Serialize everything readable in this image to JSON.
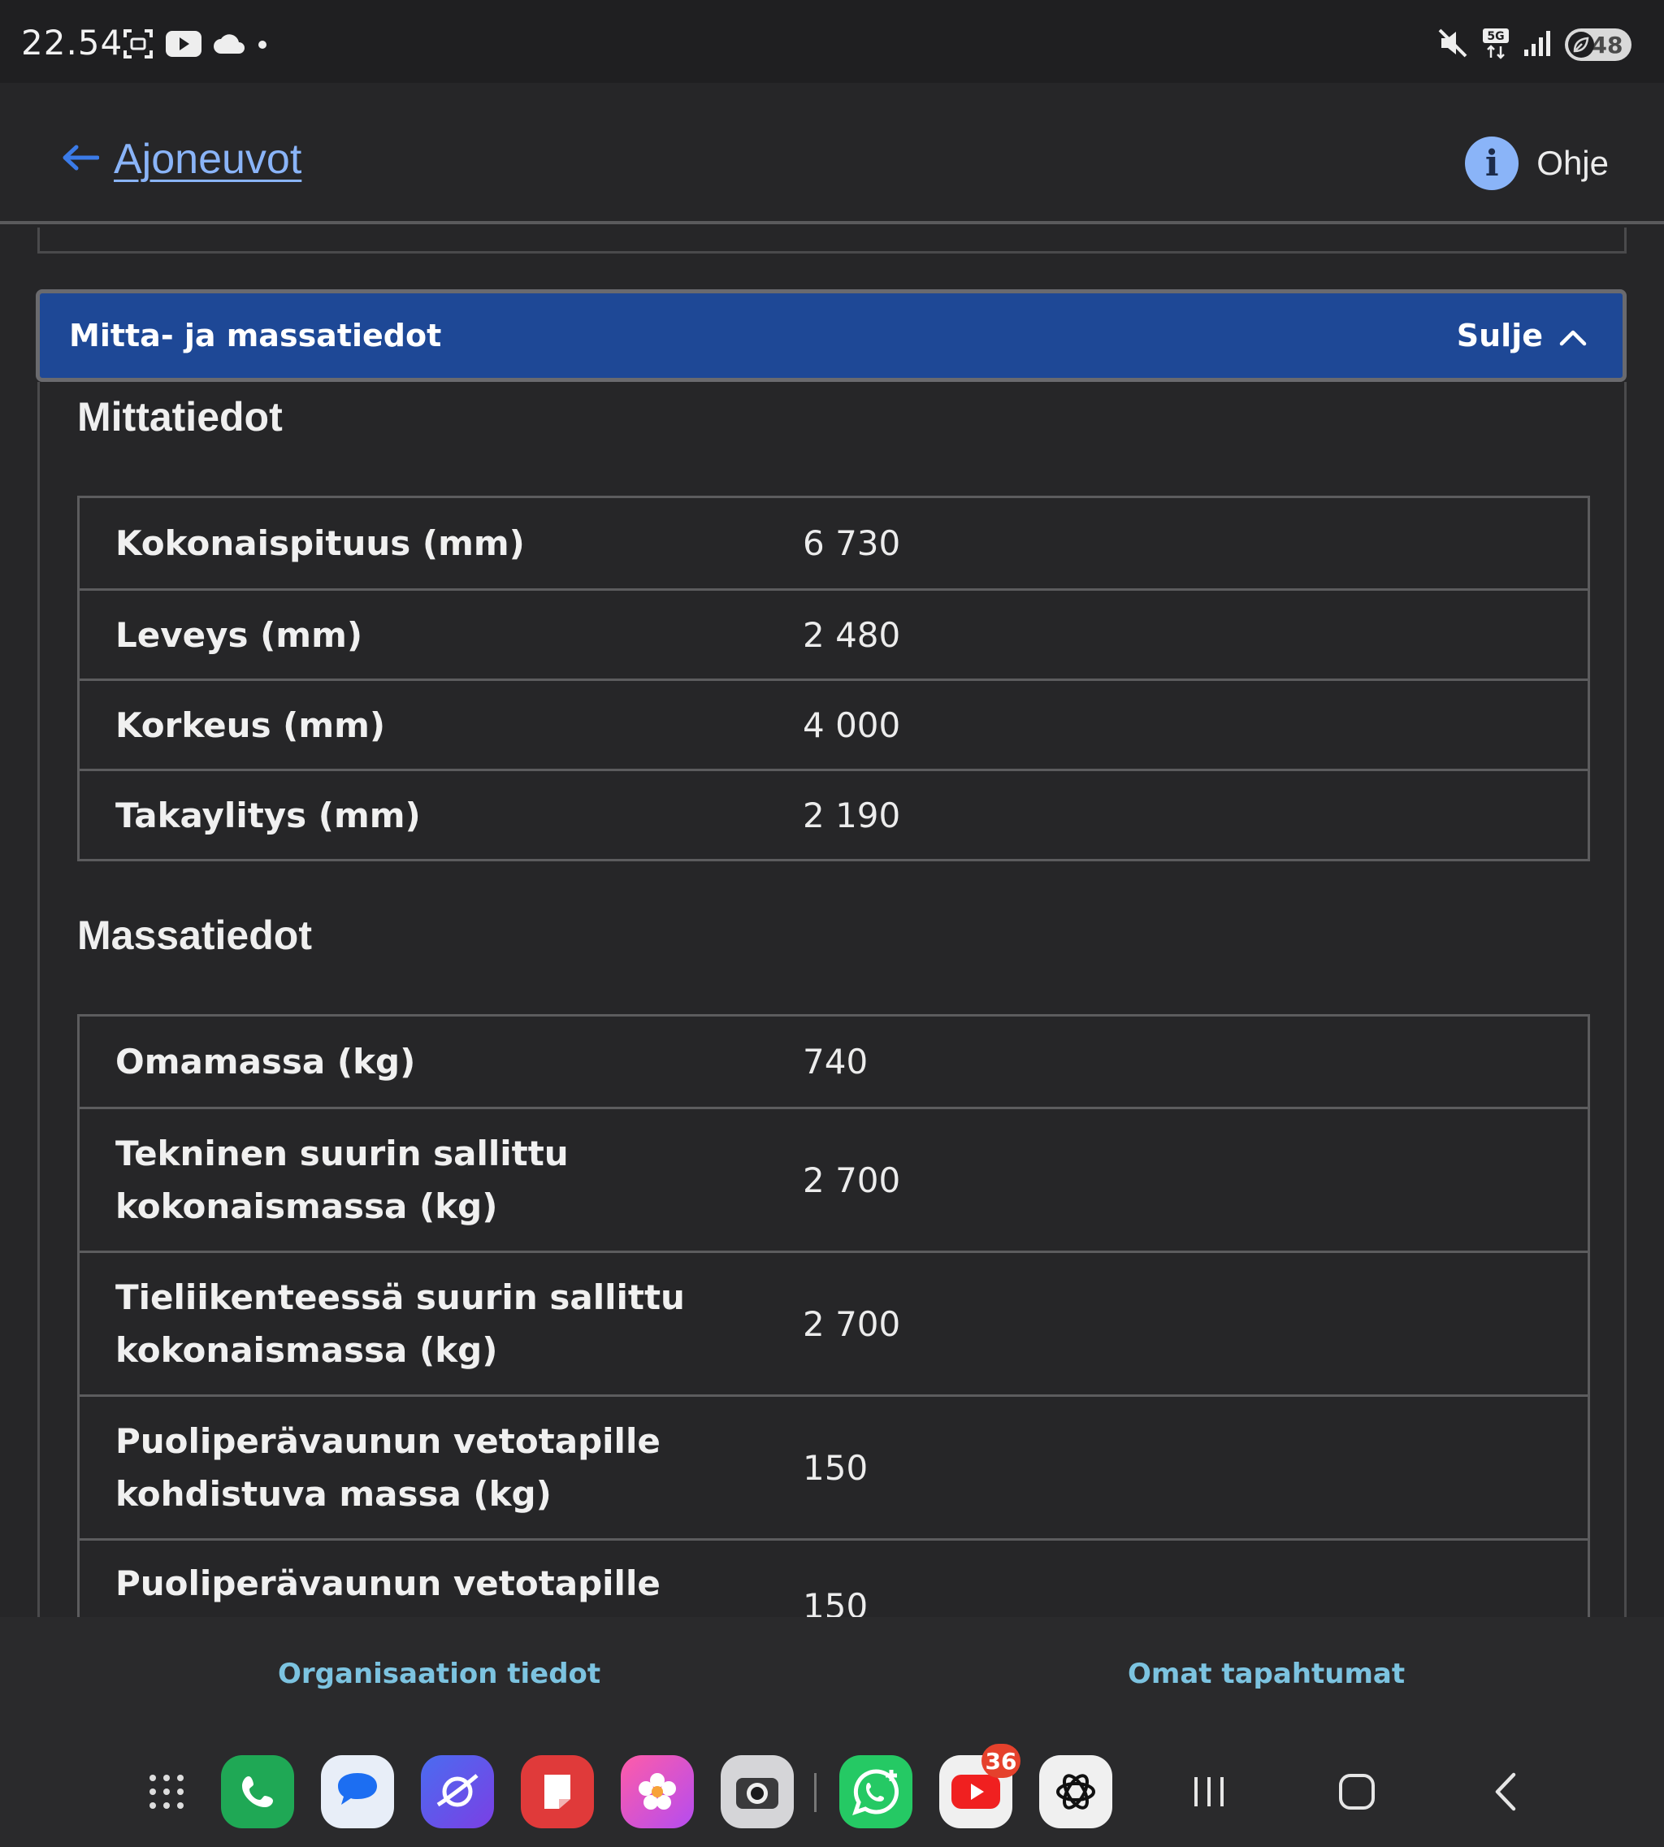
{
  "status_bar": {
    "time": "22.54",
    "battery_level": "48",
    "network": "5G"
  },
  "header": {
    "back_label": "Ajoneuvot",
    "help_label": "Ohje"
  },
  "section": {
    "title": "Mitta- ja massatiedot",
    "toggle_label": "Sulje"
  },
  "dimensions": {
    "heading": "Mittatiedot",
    "rows": [
      {
        "label": "Kokonaispituus (mm)",
        "value": "6 730"
      },
      {
        "label": "Leveys (mm)",
        "value": "2 480"
      },
      {
        "label": "Korkeus (mm)",
        "value": "4 000"
      },
      {
        "label": "Takaylitys (mm)",
        "value": "2 190"
      }
    ]
  },
  "masses": {
    "heading": "Massatiedot",
    "rows": [
      {
        "label": "Omamassa (kg)",
        "value": "740"
      },
      {
        "label": "Tekninen suurin sallittu kokonaismassa (kg)",
        "value": "2 700"
      },
      {
        "label": "Tieliikenteessä suurin sallittu kokonaismassa (kg)",
        "value": "2 700"
      },
      {
        "label": "Puoliperävaunun vetotapille kohdistuva massa (kg)",
        "value": "150"
      },
      {
        "label": "Puoliperävaunun vetotapille",
        "value": "150"
      }
    ]
  },
  "bottom_nav": {
    "left_label": "Organisaation tiedot",
    "right_label": "Omat tapahtumat"
  },
  "dock": {
    "youtube_badge": "36"
  },
  "colors": {
    "accent_link": "#8ab4f8",
    "section_bar": "#1e4896",
    "bottom_link": "#7cc3e0",
    "background": "#262628"
  }
}
